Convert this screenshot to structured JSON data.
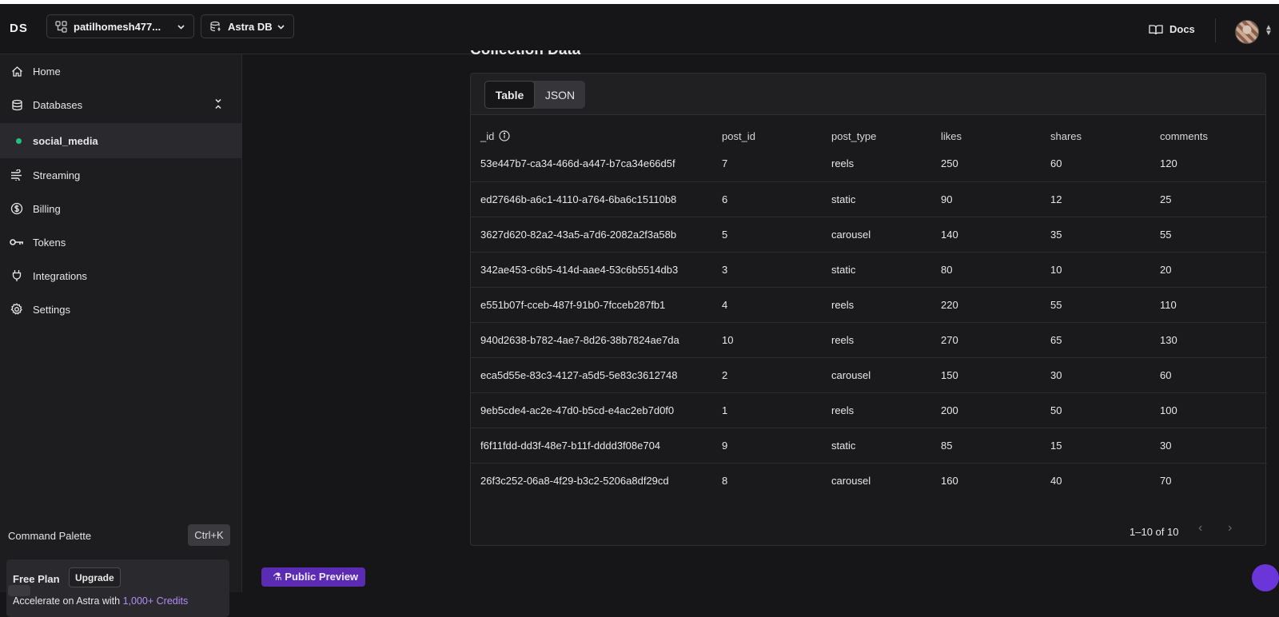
{
  "topbar": {
    "logo": "DS",
    "org_selector": "patilhomesh477...",
    "product_selector": "Astra DB",
    "docs_label": "Docs"
  },
  "sidebar": {
    "items": [
      {
        "label": "Home",
        "icon": "home-icon"
      },
      {
        "label": "Databases",
        "icon": "database-icon"
      },
      {
        "label": "social_media",
        "icon": "status-dot",
        "active": true
      },
      {
        "label": "Streaming",
        "icon": "streaming-icon"
      },
      {
        "label": "Billing",
        "icon": "billing-icon"
      },
      {
        "label": "Tokens",
        "icon": "key-icon"
      },
      {
        "label": "Integrations",
        "icon": "plug-icon"
      },
      {
        "label": "Settings",
        "icon": "gear-icon"
      }
    ],
    "command_palette": "Command Palette",
    "shortcut": "Ctrl+K",
    "plan": {
      "title": "Free Plan",
      "upgrade": "Upgrade",
      "subtitle_prefix": "Accelerate on Astra with ",
      "credits": "1,000+ Credits"
    }
  },
  "main": {
    "section_title": "Collection Data",
    "tabs": [
      "Table",
      "JSON"
    ],
    "active_tab": "Table",
    "columns": [
      "_id",
      "post_id",
      "post_type",
      "likes",
      "shares",
      "comments"
    ],
    "rows": [
      [
        "53e447b7-ca34-466d-a447-b7ca34e66d5f",
        "7",
        "reels",
        "250",
        "60",
        "120"
      ],
      [
        "ed27646b-a6c1-4110-a764-6ba6c15110b8",
        "6",
        "static",
        "90",
        "12",
        "25"
      ],
      [
        "3627d620-82a2-43a5-a7d6-2082a2f3a58b",
        "5",
        "carousel",
        "140",
        "35",
        "55"
      ],
      [
        "342ae453-c6b5-414d-aae4-53c6b5514db3",
        "3",
        "static",
        "80",
        "10",
        "20"
      ],
      [
        "e551b07f-cceb-487f-91b0-7fcceb287fb1",
        "4",
        "reels",
        "220",
        "55",
        "110"
      ],
      [
        "940d2638-b782-4ae7-8d26-38b7824ae7da",
        "10",
        "reels",
        "270",
        "65",
        "130"
      ],
      [
        "eca5d55e-83c3-4127-a5d5-5e83c3612748",
        "2",
        "carousel",
        "150",
        "30",
        "60"
      ],
      [
        "9eb5cde4-ac2e-47d0-b5cd-e4ac2eb7d0f0",
        "1",
        "reels",
        "200",
        "50",
        "100"
      ],
      [
        "f6f11fdd-dd3f-48e7-b11f-dddd3f08e704",
        "9",
        "static",
        "85",
        "15",
        "30"
      ],
      [
        "26f3c252-06a8-4f29-b3c2-5206a8df29cd",
        "8",
        "carousel",
        "160",
        "40",
        "70"
      ]
    ],
    "pagination": "1–10 of 10",
    "public_preview": "Public Preview"
  },
  "colors": {
    "background": "#161618",
    "sidebar": "#1d1d20",
    "active_dot": "#21c183",
    "credits_link": "#b38cf8",
    "preview_badge": "#5b2bb3"
  }
}
